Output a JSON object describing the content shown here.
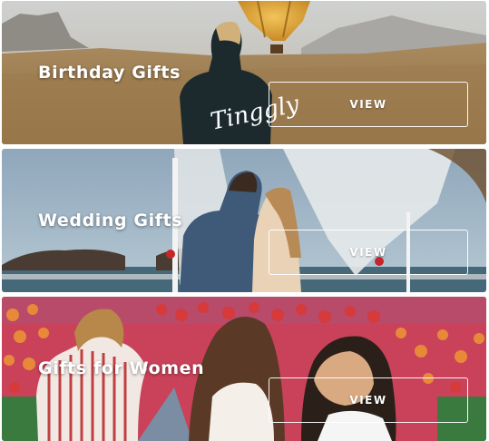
{
  "cards": [
    {
      "title": "Birthday Gifts",
      "button_label": "VIEW",
      "shirt_text": "Tinggly"
    },
    {
      "title": "Wedding Gifts",
      "button_label": "VIEW"
    },
    {
      "title": "Gifts for Women",
      "button_label": "VIEW"
    }
  ],
  "colors": {
    "overlay_text": "#ffffff",
    "button_border": "#ffffff"
  }
}
